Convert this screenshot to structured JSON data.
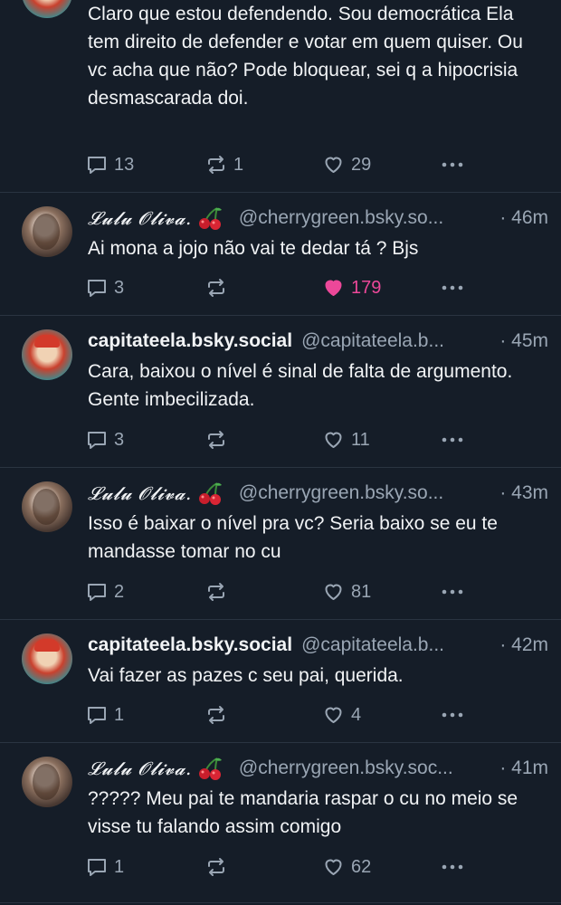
{
  "posts": [
    {
      "text": "Claro que estou defendendo. Sou democrática  Ela tem direito de defender e votar em quem quiser. Ou vc acha que não? Pode bloquear, sei q a hipocrisia desmascarada doi.",
      "replies": "13",
      "reposts": "1",
      "likes": "29"
    },
    {
      "display_name": "𝓛𝓾𝓵𝓾 𝓞𝓵𝓲𝓿𝓪.",
      "handle": "@cherrygreen.bsky.so...",
      "time": "· 46m",
      "text": "Ai mona a jojo não vai te dedar tá ? Bjs",
      "replies": "3",
      "reposts": "",
      "likes": "179",
      "liked": true
    },
    {
      "display_name": "capitateela.bsky.social",
      "handle": "@capitateela.b...",
      "time": "· 45m",
      "text": "Cara, baixou o nível é sinal de falta de argumento. Gente imbecilizada.",
      "replies": "3",
      "reposts": "",
      "likes": "11"
    },
    {
      "display_name": "𝓛𝓾𝓵𝓾 𝓞𝓵𝓲𝓿𝓪.",
      "handle": "@cherrygreen.bsky.so...",
      "time": "· 43m",
      "text": "Isso é baixar o nível pra vc? Seria baixo se eu te mandasse tomar no cu",
      "replies": "2",
      "reposts": "",
      "likes": "81"
    },
    {
      "display_name": "capitateela.bsky.social",
      "handle": "@capitateela.b...",
      "time": "· 42m",
      "text": "Vai fazer as pazes c seu pai, querida.",
      "replies": "1",
      "reposts": "",
      "likes": "4"
    },
    {
      "display_name": "𝓛𝓾𝓵𝓾 𝓞𝓵𝓲𝓿𝓪.",
      "handle": "@cherrygreen.bsky.soc...",
      "time": "· 41m",
      "text": "????? Meu pai te mandaria raspar o cu  no meio se visse tu falando assim comigo",
      "replies": "1",
      "reposts": "",
      "likes": "62"
    }
  ],
  "icons": {
    "reply": "reply-icon",
    "repost": "repost-icon",
    "like": "heart-icon",
    "more": "more-icon",
    "emoji": "cherry-emoji"
  },
  "colors": {
    "background": "#151d28",
    "muted": "#9aa6b4",
    "like_active": "#ec4899"
  }
}
